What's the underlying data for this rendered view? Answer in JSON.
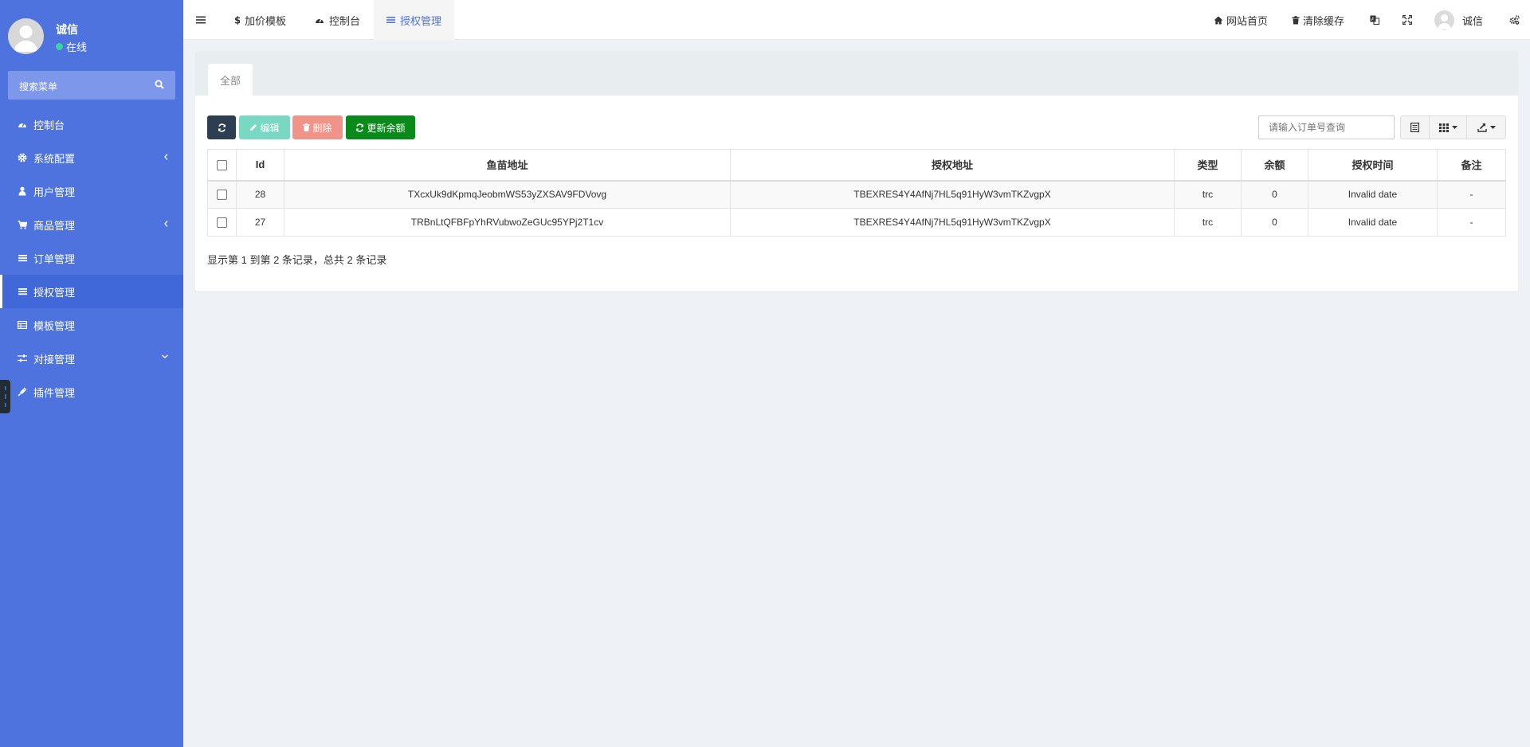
{
  "sidebar": {
    "user_name": "诚信",
    "user_status": "在线",
    "search_placeholder": "搜索菜单",
    "items": [
      {
        "label": "控制台",
        "icon": "dashboard-icon"
      },
      {
        "label": "系统配置",
        "icon": "gear-icon",
        "arrow": "chevron-left-icon"
      },
      {
        "label": "用户管理",
        "icon": "user-icon"
      },
      {
        "label": "商品管理",
        "icon": "cart-icon",
        "arrow": "chevron-left-icon"
      },
      {
        "label": "订单管理",
        "icon": "list-icon"
      },
      {
        "label": "授权管理",
        "icon": "list-icon",
        "active": true
      },
      {
        "label": "模板管理",
        "icon": "table-icon"
      },
      {
        "label": "对接管理",
        "icon": "sliders-icon",
        "arrow": "chevron-down-icon"
      },
      {
        "label": "插件管理",
        "icon": "plug-icon"
      }
    ]
  },
  "topbar": {
    "tabs": [
      {
        "label": "加价模板",
        "icon": "dollar-icon"
      },
      {
        "label": "控制台",
        "icon": "dashboard-icon"
      },
      {
        "label": "授权管理",
        "icon": "list-icon",
        "active": true
      }
    ],
    "home_label": "网站首页",
    "clear_cache_label": "清除缓存",
    "user_name": "诚信"
  },
  "content": {
    "tab_all": "全部",
    "buttons": {
      "edit": "编辑",
      "delete": "删除",
      "update_balance": "更新余额"
    },
    "search_placeholder": "请输入订单号查询",
    "table": {
      "columns": [
        "Id",
        "鱼苗地址",
        "授权地址",
        "类型",
        "余额",
        "授权时间",
        "备注"
      ],
      "rows": [
        {
          "id": "28",
          "fish_address": "TXcxUk9dKpmqJeobmWS53yZXSAV9FDVovg",
          "auth_address": "TBEXRES4Y4AfNj7HL5q91HyW3vmTKZvgpX",
          "type": "trc",
          "balance": "0",
          "auth_time": "Invalid date",
          "remark": "-"
        },
        {
          "id": "27",
          "fish_address": "TRBnLtQFBFpYhRVubwoZeGUc95YPj2T1cv",
          "auth_address": "TBEXRES4Y4AfNj7HL5q91HyW3vmTKZvgpX",
          "type": "trc",
          "balance": "0",
          "auth_time": "Invalid date",
          "remark": "-"
        }
      ]
    },
    "pagination_info": "显示第 1 到第 2 条记录，总共 2 条记录"
  },
  "colors": {
    "sidebar_bg": "#4e73df",
    "accent": "#4e73df",
    "btn_dark": "#2c3e50",
    "btn_edit": "#78d8c2",
    "btn_delete": "#f0948a",
    "btn_update": "#0a8a1a",
    "online": "#3dd3a0"
  }
}
